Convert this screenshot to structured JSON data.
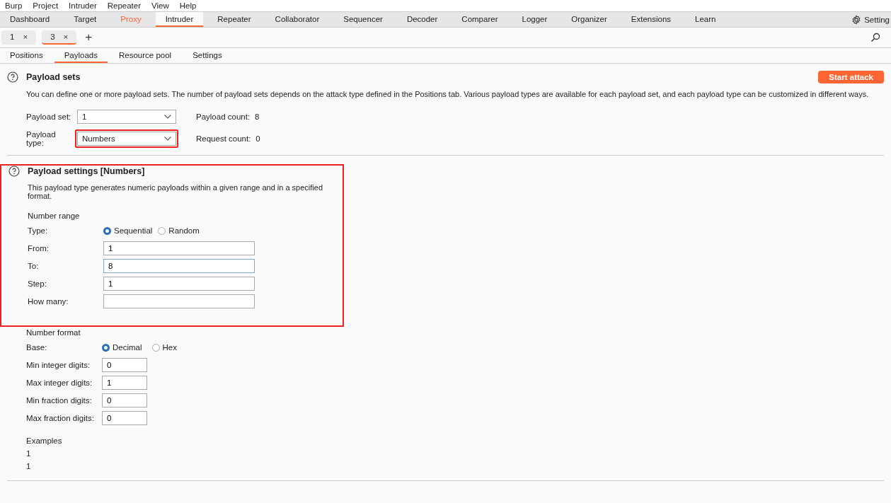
{
  "menu_bar": [
    "Burp",
    "Project",
    "Intruder",
    "Repeater",
    "View",
    "Help"
  ],
  "main_tabs": [
    {
      "label": "Dashboard",
      "selected": false,
      "highlighted": false
    },
    {
      "label": "Target",
      "selected": false,
      "highlighted": false
    },
    {
      "label": "Proxy",
      "selected": false,
      "highlighted": true
    },
    {
      "label": "Intruder",
      "selected": true,
      "highlighted": false
    },
    {
      "label": "Repeater",
      "selected": false,
      "highlighted": false
    },
    {
      "label": "Collaborator",
      "selected": false,
      "highlighted": false
    },
    {
      "label": "Sequencer",
      "selected": false,
      "highlighted": false
    },
    {
      "label": "Decoder",
      "selected": false,
      "highlighted": false
    },
    {
      "label": "Comparer",
      "selected": false,
      "highlighted": false
    },
    {
      "label": "Logger",
      "selected": false,
      "highlighted": false
    },
    {
      "label": "Organizer",
      "selected": false,
      "highlighted": false
    },
    {
      "label": "Extensions",
      "selected": false,
      "highlighted": false
    },
    {
      "label": "Learn",
      "selected": false,
      "highlighted": false
    }
  ],
  "settings_button": {
    "label": "Setting"
  },
  "attack_tabs": [
    {
      "label": "1",
      "close": "×",
      "selected": false
    },
    {
      "label": "3",
      "close": "×",
      "selected": true
    }
  ],
  "new_tab": "+",
  "sub_tabs": [
    {
      "label": "Positions",
      "selected": false
    },
    {
      "label": "Payloads",
      "selected": true
    },
    {
      "label": "Resource pool",
      "selected": false
    },
    {
      "label": "Settings",
      "selected": false
    }
  ],
  "payload_sets": {
    "title": "Payload sets",
    "description": "You can define one or more payload sets. The number of payload sets depends on the attack type defined in the Positions tab. Various payload types are available for each payload set, and each payload type can be customized in different ways.",
    "start_button": "Start attack",
    "selects": [
      {
        "label": "Payload set:",
        "value": "1",
        "highlighted": false
      },
      {
        "label": "Payload type:",
        "value": "Numbers",
        "highlighted": true
      }
    ],
    "counts": [
      {
        "label": "Payload count:",
        "value": "8"
      },
      {
        "label": "Request count:",
        "value": "0"
      }
    ]
  },
  "payload_settings": {
    "title": "Payload settings [Numbers]",
    "description": "This payload type generates numeric payloads within a given range and in a specified format.",
    "highlighted": true,
    "number_range": {
      "heading": "Number range",
      "type_label": "Type:",
      "options": [
        {
          "label": "Sequential",
          "selected": true
        },
        {
          "label": "Random",
          "selected": false
        }
      ],
      "fields": [
        {
          "label": "From:",
          "value": "1",
          "focused": false
        },
        {
          "label": "To:",
          "value": "8",
          "focused": true
        },
        {
          "label": "Step:",
          "value": "1",
          "focused": false
        },
        {
          "label": "How many:",
          "focused": false
        }
      ]
    },
    "number_format": {
      "heading": "Number format",
      "base_label": "Base:",
      "options": [
        {
          "label": "Decimal",
          "selected": true
        },
        {
          "label": "Hex",
          "selected": false
        }
      ],
      "fields": [
        {
          "label": "Min integer digits:",
          "value": "0"
        },
        {
          "label": "Max integer digits:",
          "value": "1"
        },
        {
          "label": "Min fraction digits:",
          "value": "0"
        },
        {
          "label": "Max fraction digits:",
          "value": "0"
        }
      ]
    },
    "examples": {
      "heading": "Examples",
      "items": [
        "1",
        "1"
      ]
    }
  }
}
